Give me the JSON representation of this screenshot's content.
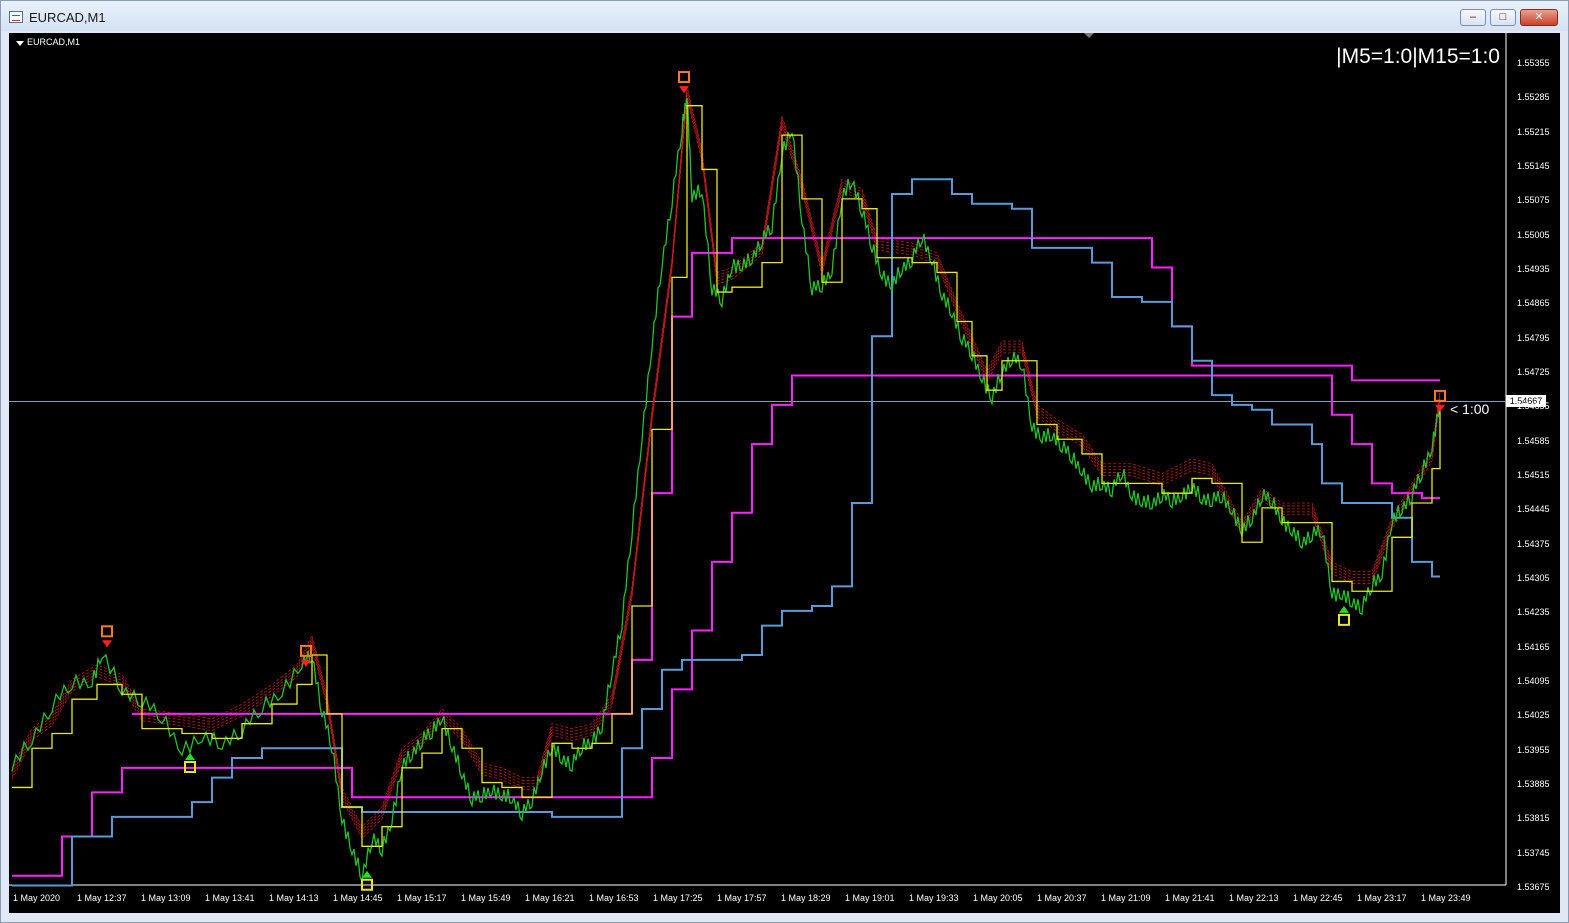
{
  "window": {
    "title": "EURCAD,M1",
    "minimize_icon": "minimize-icon",
    "maximize_icon": "restore-icon",
    "close_icon": "close-icon"
  },
  "chart": {
    "symbol_label": "EURCAD,M1",
    "mtf_status": "|M5=1:0|M15=1:0",
    "timer_label": "< 1:00",
    "current_price": "1.54667",
    "colors": {
      "background": "#000000",
      "price": "#22c32a",
      "fast_line": "#e8e81a",
      "blue_line": "#5b9bd5",
      "magenta_line": "#ff22ff",
      "envelope": "#e02020",
      "crosshair": "#7f9fb5"
    }
  },
  "chart_data": {
    "type": "line",
    "symbol": "EURCAD",
    "timeframe": "M1",
    "y_ticks": [
      "1.55355",
      "1.55285",
      "1.55215",
      "1.55145",
      "1.55075",
      "1.55005",
      "1.54935",
      "1.54865",
      "1.54795",
      "1.54725",
      "1.54655",
      "1.54585",
      "1.54515",
      "1.54445",
      "1.54375",
      "1.54305",
      "1.54235",
      "1.54165",
      "1.54095",
      "1.54025",
      "1.53955",
      "1.53885",
      "1.53815",
      "1.53745",
      "1.53675"
    ],
    "x_ticks": [
      "1 May 2020",
      "1 May 12:37",
      "1 May 13:09",
      "1 May 13:41",
      "1 May 14:13",
      "1 May 14:45",
      "1 May 15:17",
      "1 May 15:49",
      "1 May 16:21",
      "1 May 16:53",
      "1 May 17:25",
      "1 May 17:57",
      "1 May 18:29",
      "1 May 19:01",
      "1 May 19:33",
      "1 May 20:05",
      "1 May 20:37",
      "1 May 21:09",
      "1 May 21:41",
      "1 May 22:13",
      "1 May 22:45",
      "1 May 23:17",
      "1 May 23:49"
    ],
    "ylim": [
      1.53675,
      1.55355
    ],
    "price_series": [
      [
        0,
        1.5392
      ],
      [
        20,
        1.5398
      ],
      [
        40,
        1.5405
      ],
      [
        60,
        1.5409
      ],
      [
        80,
        1.541
      ],
      [
        90,
        1.5415
      ],
      [
        110,
        1.5408
      ],
      [
        130,
        1.5406
      ],
      [
        150,
        1.5402
      ],
      [
        170,
        1.5396
      ],
      [
        190,
        1.5398
      ],
      [
        210,
        1.5397
      ],
      [
        230,
        1.54
      ],
      [
        250,
        1.5404
      ],
      [
        270,
        1.5408
      ],
      [
        290,
        1.5413
      ],
      [
        300,
        1.5415
      ],
      [
        310,
        1.5404
      ],
      [
        320,
        1.5396
      ],
      [
        330,
        1.5382
      ],
      [
        340,
        1.5375
      ],
      [
        350,
        1.537
      ],
      [
        360,
        1.5378
      ],
      [
        370,
        1.5375
      ],
      [
        380,
        1.5382
      ],
      [
        390,
        1.5392
      ],
      [
        400,
        1.5395
      ],
      [
        410,
        1.5398
      ],
      [
        420,
        1.5399
      ],
      [
        430,
        1.5403
      ],
      [
        440,
        1.5396
      ],
      [
        450,
        1.5391
      ],
      [
        460,
        1.5386
      ],
      [
        470,
        1.5386
      ],
      [
        480,
        1.5388
      ],
      [
        490,
        1.5386
      ],
      [
        500,
        1.5386
      ],
      [
        510,
        1.5383
      ],
      [
        520,
        1.5385
      ],
      [
        530,
        1.5392
      ],
      [
        540,
        1.5396
      ],
      [
        550,
        1.5394
      ],
      [
        560,
        1.5393
      ],
      [
        570,
        1.5396
      ],
      [
        580,
        1.5398
      ],
      [
        590,
        1.54
      ],
      [
        600,
        1.5412
      ],
      [
        610,
        1.5422
      ],
      [
        620,
        1.544
      ],
      [
        630,
        1.546
      ],
      [
        640,
        1.5478
      ],
      [
        650,
        1.5495
      ],
      [
        660,
        1.5508
      ],
      [
        670,
        1.5522
      ],
      [
        675,
        1.553
      ],
      [
        680,
        1.5508
      ],
      [
        690,
        1.551
      ],
      [
        700,
        1.549
      ],
      [
        710,
        1.5487
      ],
      [
        720,
        1.5495
      ],
      [
        730,
        1.5494
      ],
      [
        740,
        1.5496
      ],
      [
        750,
        1.55
      ],
      [
        760,
        1.5502
      ],
      [
        770,
        1.5518
      ],
      [
        780,
        1.5522
      ],
      [
        790,
        1.5504
      ],
      [
        800,
        1.549
      ],
      [
        810,
        1.549
      ],
      [
        820,
        1.5494
      ],
      [
        830,
        1.5508
      ],
      [
        840,
        1.5512
      ],
      [
        850,
        1.5506
      ],
      [
        860,
        1.5498
      ],
      [
        870,
        1.5493
      ],
      [
        880,
        1.549
      ],
      [
        890,
        1.5494
      ],
      [
        900,
        1.5496
      ],
      [
        910,
        1.55
      ],
      [
        920,
        1.5496
      ],
      [
        930,
        1.5488
      ],
      [
        940,
        1.5485
      ],
      [
        950,
        1.548
      ],
      [
        960,
        1.5476
      ],
      [
        970,
        1.5472
      ],
      [
        980,
        1.5467
      ],
      [
        990,
        1.5473
      ],
      [
        1000,
        1.5476
      ],
      [
        1010,
        1.5474
      ],
      [
        1020,
        1.5462
      ],
      [
        1030,
        1.5459
      ],
      [
        1040,
        1.546
      ],
      [
        1050,
        1.5458
      ],
      [
        1060,
        1.5455
      ],
      [
        1070,
        1.5453
      ],
      [
        1080,
        1.5449
      ],
      [
        1090,
        1.545
      ],
      [
        1100,
        1.5449
      ],
      [
        1110,
        1.5452
      ],
      [
        1120,
        1.5448
      ],
      [
        1130,
        1.5446
      ],
      [
        1140,
        1.5446
      ],
      [
        1150,
        1.5448
      ],
      [
        1160,
        1.5446
      ],
      [
        1170,
        1.5448
      ],
      [
        1180,
        1.5449
      ],
      [
        1190,
        1.5447
      ],
      [
        1200,
        1.5447
      ],
      [
        1210,
        1.5447
      ],
      [
        1220,
        1.5445
      ],
      [
        1230,
        1.544
      ],
      [
        1240,
        1.5443
      ],
      [
        1250,
        1.5448
      ],
      [
        1260,
        1.5446
      ],
      [
        1270,
        1.5443
      ],
      [
        1280,
        1.544
      ],
      [
        1290,
        1.5438
      ],
      [
        1300,
        1.544
      ],
      [
        1310,
        1.544
      ],
      [
        1320,
        1.5428
      ],
      [
        1330,
        1.5427
      ],
      [
        1340,
        1.5426
      ],
      [
        1350,
        1.5425
      ],
      [
        1360,
        1.5429
      ],
      [
        1370,
        1.5432
      ],
      [
        1380,
        1.5442
      ],
      [
        1390,
        1.5445
      ],
      [
        1400,
        1.5448
      ],
      [
        1410,
        1.5452
      ],
      [
        1420,
        1.5458
      ],
      [
        1428,
        1.5466
      ]
    ],
    "yellow_series": [
      [
        0,
        1.5388
      ],
      [
        20,
        1.5396
      ],
      [
        40,
        1.5399
      ],
      [
        60,
        1.5406
      ],
      [
        85,
        1.5409
      ],
      [
        110,
        1.5407
      ],
      [
        130,
        1.54
      ],
      [
        170,
        1.5399
      ],
      [
        200,
        1.5398
      ],
      [
        230,
        1.5401
      ],
      [
        260,
        1.5405
      ],
      [
        285,
        1.5409
      ],
      [
        300,
        1.5415
      ],
      [
        315,
        1.5403
      ],
      [
        330,
        1.5384
      ],
      [
        350,
        1.5376
      ],
      [
        370,
        1.538
      ],
      [
        390,
        1.5392
      ],
      [
        410,
        1.5395
      ],
      [
        430,
        1.54
      ],
      [
        450,
        1.5396
      ],
      [
        470,
        1.5389
      ],
      [
        490,
        1.5388
      ],
      [
        510,
        1.5386
      ],
      [
        525,
        1.5386
      ],
      [
        540,
        1.5397
      ],
      [
        560,
        1.5396
      ],
      [
        580,
        1.5397
      ],
      [
        600,
        1.5403
      ],
      [
        620,
        1.5425
      ],
      [
        640,
        1.5461
      ],
      [
        660,
        1.5492
      ],
      [
        675,
        1.5527
      ],
      [
        690,
        1.5514
      ],
      [
        705,
        1.5489
      ],
      [
        720,
        1.549
      ],
      [
        750,
        1.5495
      ],
      [
        770,
        1.5521
      ],
      [
        790,
        1.5508
      ],
      [
        810,
        1.5491
      ],
      [
        830,
        1.5508
      ],
      [
        850,
        1.5506
      ],
      [
        865,
        1.5496
      ],
      [
        900,
        1.5495
      ],
      [
        925,
        1.5493
      ],
      [
        945,
        1.5483
      ],
      [
        960,
        1.5476
      ],
      [
        975,
        1.5469
      ],
      [
        990,
        1.5475
      ],
      [
        1010,
        1.5475
      ],
      [
        1025,
        1.5462
      ],
      [
        1045,
        1.5459
      ],
      [
        1070,
        1.5456
      ],
      [
        1090,
        1.545
      ],
      [
        1120,
        1.545
      ],
      [
        1150,
        1.5448
      ],
      [
        1180,
        1.5451
      ],
      [
        1200,
        1.545
      ],
      [
        1230,
        1.5438
      ],
      [
        1250,
        1.5445
      ],
      [
        1270,
        1.5442
      ],
      [
        1300,
        1.5442
      ],
      [
        1320,
        1.543
      ],
      [
        1340,
        1.5428
      ],
      [
        1360,
        1.5428
      ],
      [
        1380,
        1.5439
      ],
      [
        1400,
        1.5446
      ],
      [
        1420,
        1.5453
      ],
      [
        1428,
        1.5465
      ]
    ],
    "blue_series": [
      [
        0,
        1.5368
      ],
      [
        30,
        1.5368
      ],
      [
        60,
        1.5378
      ],
      [
        100,
        1.5382
      ],
      [
        180,
        1.5385
      ],
      [
        200,
        1.539
      ],
      [
        220,
        1.5394
      ],
      [
        250,
        1.5396
      ],
      [
        300,
        1.5396
      ],
      [
        330,
        1.5384
      ],
      [
        350,
        1.5383
      ],
      [
        400,
        1.5383
      ],
      [
        460,
        1.5383
      ],
      [
        510,
        1.5383
      ],
      [
        540,
        1.5382
      ],
      [
        580,
        1.5382
      ],
      [
        600,
        1.5382
      ],
      [
        610,
        1.5396
      ],
      [
        630,
        1.5404
      ],
      [
        650,
        1.5412
      ],
      [
        670,
        1.5414
      ],
      [
        700,
        1.5414
      ],
      [
        730,
        1.5415
      ],
      [
        750,
        1.5421
      ],
      [
        770,
        1.5424
      ],
      [
        800,
        1.5425
      ],
      [
        820,
        1.5429
      ],
      [
        840,
        1.5446
      ],
      [
        860,
        1.548
      ],
      [
        880,
        1.5509
      ],
      [
        900,
        1.5512
      ],
      [
        920,
        1.5512
      ],
      [
        940,
        1.5509
      ],
      [
        960,
        1.5507
      ],
      [
        1000,
        1.5506
      ],
      [
        1020,
        1.5498
      ],
      [
        1050,
        1.5498
      ],
      [
        1080,
        1.5495
      ],
      [
        1100,
        1.5488
      ],
      [
        1130,
        1.5487
      ],
      [
        1160,
        1.5482
      ],
      [
        1180,
        1.5475
      ],
      [
        1200,
        1.5468
      ],
      [
        1220,
        1.5466
      ],
      [
        1240,
        1.5465
      ],
      [
        1260,
        1.5462
      ],
      [
        1300,
        1.5458
      ],
      [
        1310,
        1.545
      ],
      [
        1330,
        1.5446
      ],
      [
        1350,
        1.5446
      ],
      [
        1380,
        1.5443
      ],
      [
        1390,
        1.5443
      ],
      [
        1400,
        1.5434
      ],
      [
        1420,
        1.5431
      ],
      [
        1428,
        1.5431
      ]
    ],
    "magenta_series": [
      [
        0,
        1.537
      ],
      [
        20,
        1.537
      ],
      [
        50,
        1.5378
      ],
      [
        80,
        1.5387
      ],
      [
        110,
        1.5392
      ],
      [
        150,
        1.5392
      ],
      [
        200,
        1.5392
      ],
      [
        250,
        1.5392
      ],
      [
        320,
        1.5392
      ],
      [
        340,
        1.5386
      ],
      [
        380,
        1.5386
      ],
      [
        450,
        1.5386
      ],
      [
        520,
        1.5386
      ],
      [
        600,
        1.5386
      ],
      [
        620,
        1.5386
      ],
      [
        640,
        1.5394
      ],
      [
        660,
        1.5408
      ],
      [
        680,
        1.542
      ],
      [
        700,
        1.5434
      ],
      [
        720,
        1.5444
      ],
      [
        740,
        1.5458
      ],
      [
        760,
        1.5466
      ],
      [
        780,
        1.5472
      ],
      [
        820,
        1.5472
      ],
      [
        870,
        1.5472
      ],
      [
        920,
        1.5472
      ],
      [
        960,
        1.5472
      ],
      [
        1000,
        1.5472
      ],
      [
        1050,
        1.5472
      ],
      [
        1100,
        1.5472
      ],
      [
        1150,
        1.5472
      ],
      [
        1200,
        1.5472
      ],
      [
        1250,
        1.5472
      ],
      [
        1300,
        1.5472
      ],
      [
        1320,
        1.5464
      ],
      [
        1340,
        1.5458
      ],
      [
        1360,
        1.545
      ],
      [
        1380,
        1.5448
      ],
      [
        1410,
        1.5447
      ],
      [
        1428,
        1.5447
      ]
    ],
    "magenta_upper": [
      [
        120,
        1.5403
      ],
      [
        300,
        1.5403
      ],
      [
        340,
        1.5403
      ],
      [
        600,
        1.5403
      ],
      [
        620,
        1.5414
      ],
      [
        640,
        1.5448
      ],
      [
        660,
        1.5484
      ],
      [
        680,
        1.5497
      ],
      [
        720,
        1.55
      ],
      [
        760,
        1.55
      ],
      [
        800,
        1.55
      ],
      [
        860,
        1.55
      ],
      [
        900,
        1.55
      ],
      [
        1000,
        1.55
      ],
      [
        1100,
        1.55
      ],
      [
        1130,
        1.55
      ],
      [
        1140,
        1.5494
      ],
      [
        1160,
        1.5482
      ],
      [
        1180,
        1.5474
      ],
      [
        1320,
        1.5474
      ],
      [
        1340,
        1.5471
      ],
      [
        1428,
        1.5471
      ]
    ],
    "signals": [
      {
        "type": "sell",
        "x": 95,
        "y": 1.5418
      },
      {
        "type": "sell",
        "x": 294,
        "y": 1.5414
      },
      {
        "type": "buy",
        "x": 178,
        "y": 1.5394
      },
      {
        "type": "buy",
        "x": 355,
        "y": 1.537
      },
      {
        "type": "sell",
        "x": 672,
        "y": 1.5531
      },
      {
        "type": "sell",
        "x": 1428,
        "y": 1.5466
      },
      {
        "type": "buy",
        "x": 1332,
        "y": 1.5424
      }
    ]
  }
}
